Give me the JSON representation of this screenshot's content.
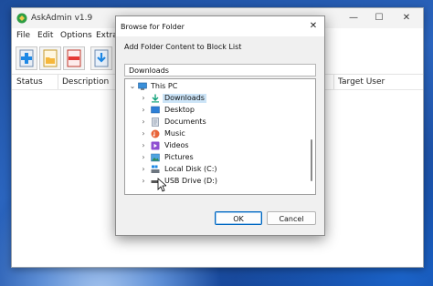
{
  "app": {
    "title": "AskAdmin v1.9",
    "menu": [
      "File",
      "Edit",
      "Options",
      "Extras"
    ],
    "toolbar_icons": [
      "add-file-icon",
      "add-folder-icon",
      "remove-icon",
      "import-icon"
    ],
    "columns": [
      "Status",
      "Description",
      "Target User"
    ]
  },
  "dialog": {
    "title": "Browse for Folder",
    "close_label": "✕",
    "prompt": "Add Folder Content to Block List",
    "path_value": "Downloads",
    "tree": [
      {
        "label": "This PC",
        "icon": "this-pc-icon",
        "expanded": true,
        "level": 0
      },
      {
        "label": "Downloads",
        "icon": "downloads-icon",
        "selected": true,
        "level": 1
      },
      {
        "label": "Desktop",
        "icon": "desktop-icon",
        "level": 1
      },
      {
        "label": "Documents",
        "icon": "documents-icon",
        "level": 1
      },
      {
        "label": "Music",
        "icon": "music-icon",
        "level": 1
      },
      {
        "label": "Videos",
        "icon": "videos-icon",
        "level": 1
      },
      {
        "label": "Pictures",
        "icon": "pictures-icon",
        "level": 1
      },
      {
        "label": "Local Disk (C:)",
        "icon": "local-disk-icon",
        "level": 1
      },
      {
        "label": "USB Drive (D:)",
        "icon": "usb-drive-icon",
        "level": 1
      }
    ],
    "ok_label": "OK",
    "cancel_label": "Cancel"
  },
  "colors": {
    "accent": "#0067c0",
    "selection": "#cce4f7",
    "wallpaper": "#2b65bf"
  }
}
